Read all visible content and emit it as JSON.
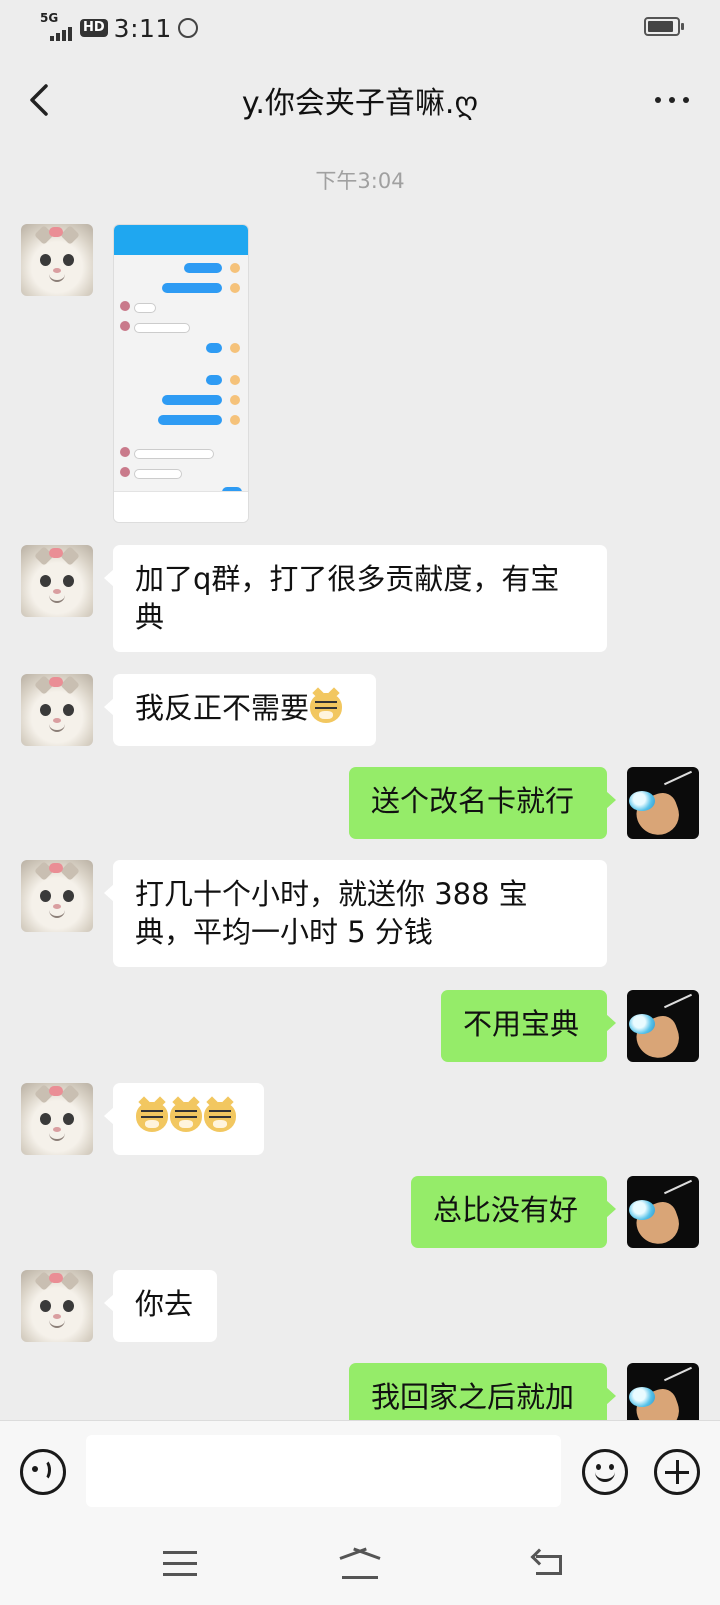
{
  "status_bar": {
    "network": "5G",
    "hd": "HD",
    "time": "3:11"
  },
  "header": {
    "title": "y.你会夹子音嘛.ღ"
  },
  "timestamp": "下午3:04",
  "messages": [
    {
      "from": "them",
      "type": "image"
    },
    {
      "from": "them",
      "text": "加了q群，打了很多贡献度，有宝典"
    },
    {
      "from": "them",
      "text": "我反正不需要"
    },
    {
      "from": "me",
      "text": "送个改名卡就行"
    },
    {
      "from": "them",
      "text": "打几十个小时，就送你 388 宝典，平均一小时 5 分钱"
    },
    {
      "from": "me",
      "text": "不用宝典"
    },
    {
      "from": "them",
      "text": ""
    },
    {
      "from": "me",
      "text": "总比没有好"
    },
    {
      "from": "them",
      "text": "你去"
    },
    {
      "from": "me",
      "text": "我回家之后就加"
    }
  ],
  "colors": {
    "background": "#ededed",
    "outgoing_bubble": "#95ec69",
    "incoming_bubble": "#ffffff"
  }
}
